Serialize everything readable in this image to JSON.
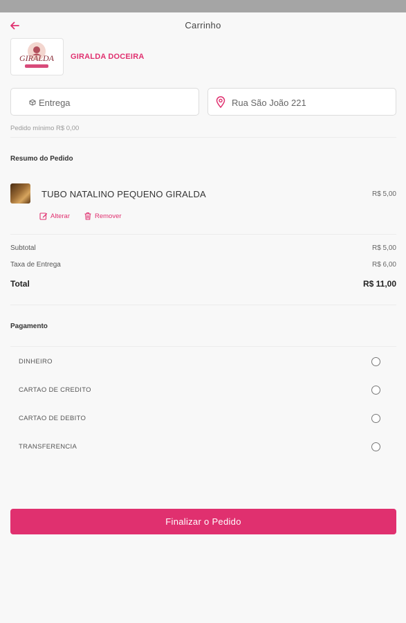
{
  "header": {
    "title": "Carrinho"
  },
  "store": {
    "name": "GIRALDA DOCEIRA",
    "logo_text": "GIRALDA"
  },
  "delivery": {
    "mode_label": "Entrega",
    "address": "Rua São João 221"
  },
  "minimum_order": "Pedido mínimo R$ 0,00",
  "summary": {
    "title": "Resumo do Pedido",
    "items": [
      {
        "name": "TUBO NATALINO PEQUENO GIRALDA",
        "price": "R$ 5,00",
        "edit_label": "Alterar",
        "remove_label": "Remover"
      }
    ]
  },
  "totals": {
    "subtotal_label": "Subtotal",
    "subtotal_value": "R$ 5,00",
    "delivery_fee_label": "Taxa de Entrega",
    "delivery_fee_value": "R$ 6,00",
    "total_label": "Total",
    "total_value": "R$ 11,00"
  },
  "payment": {
    "title": "Pagamento",
    "options": [
      "DINHEIRO",
      "CARTAO DE CREDITO",
      "CARTAO DE DEBITO",
      "TRANSFERENCIA"
    ]
  },
  "finish_button": "Finalizar o Pedido",
  "colors": {
    "accent": "#e0306f",
    "background": "#f8f8f8"
  }
}
